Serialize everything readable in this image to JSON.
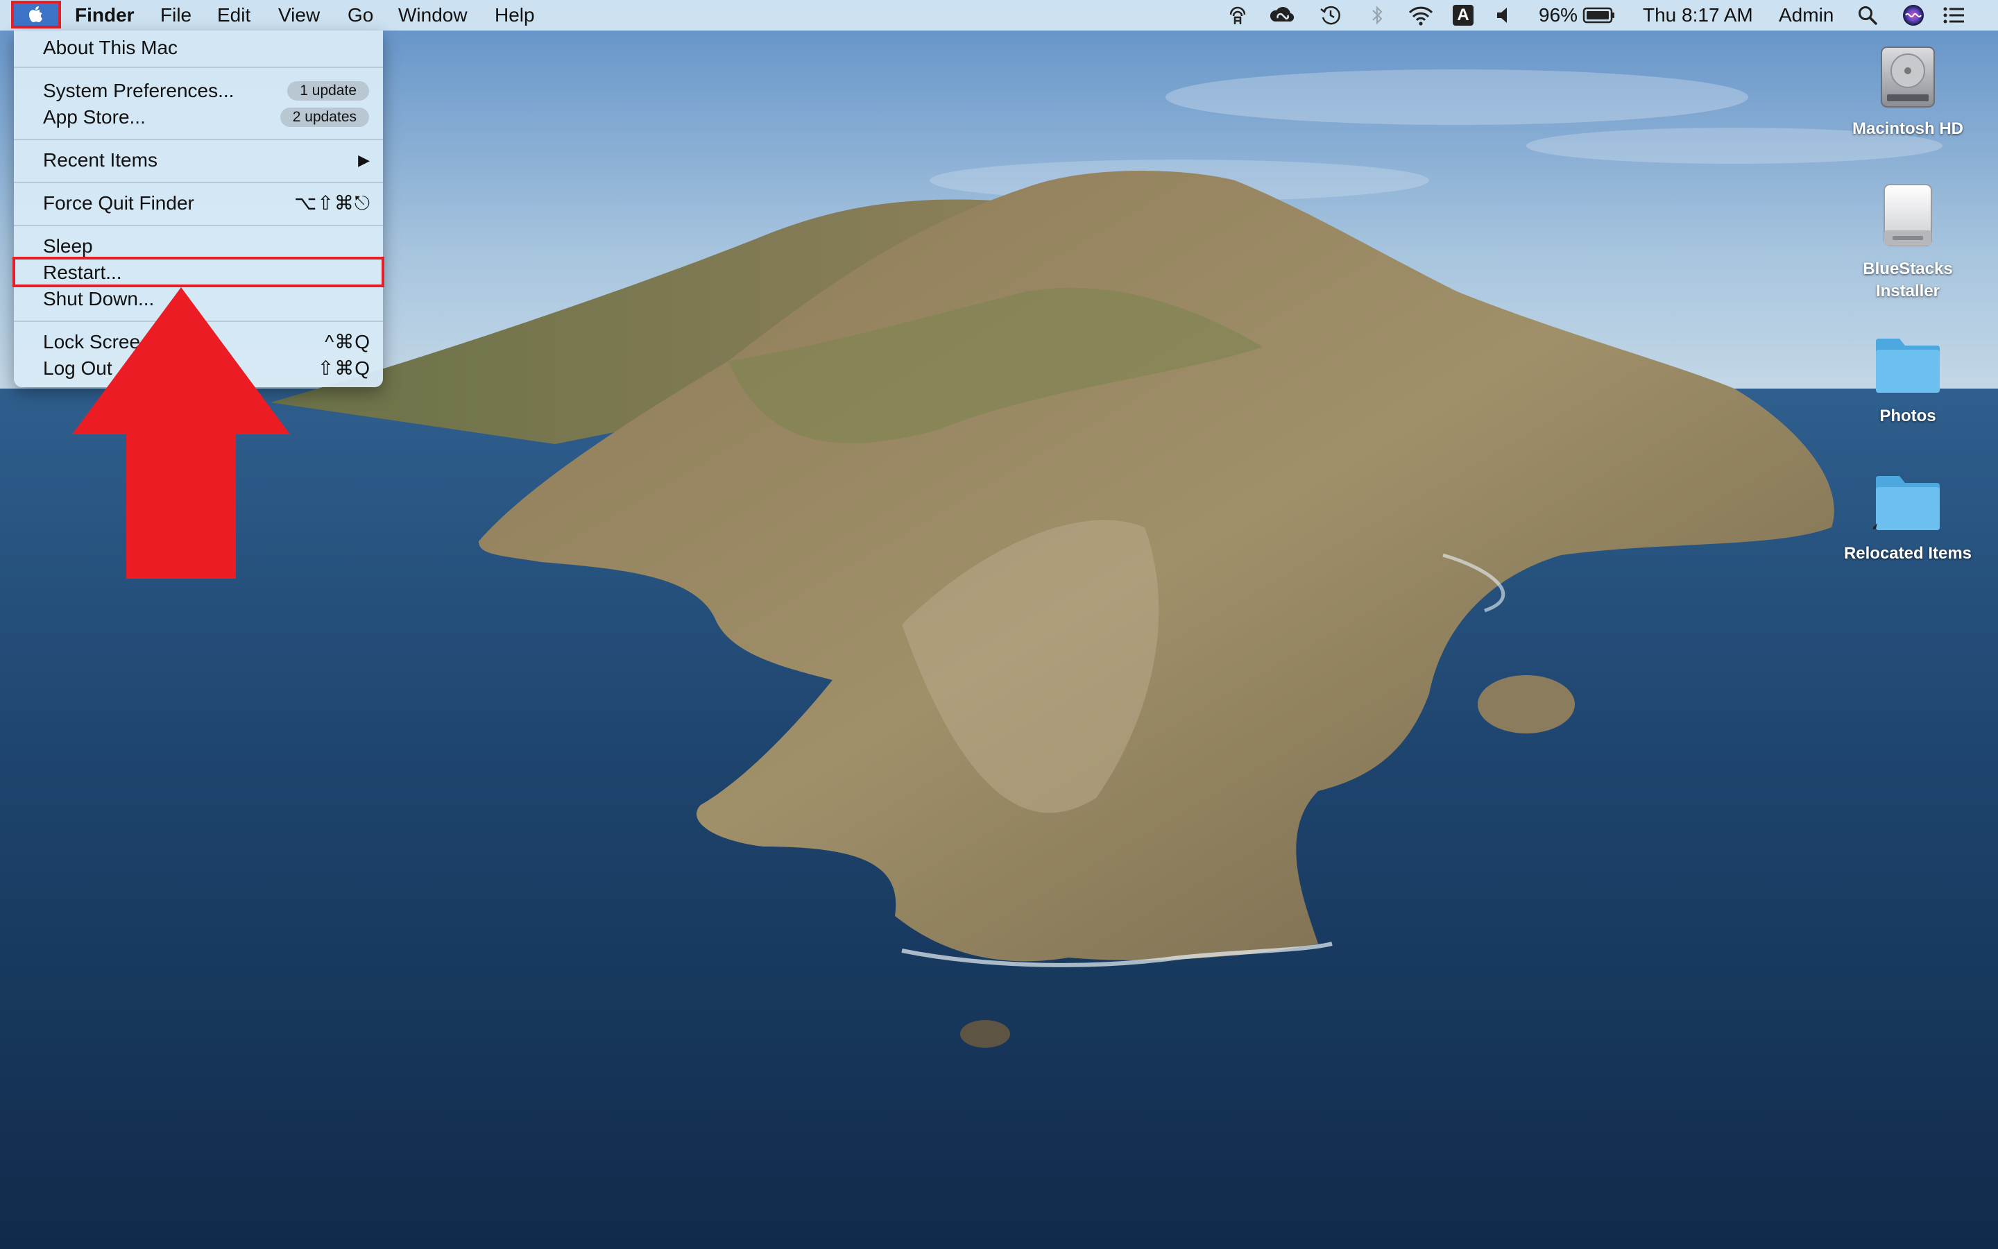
{
  "menubar": {
    "app_name": "Finder",
    "menus": [
      "File",
      "Edit",
      "View",
      "Go",
      "Window",
      "Help"
    ],
    "battery_percent": "96%",
    "clock": "Thu 8:17 AM",
    "user": "Admin",
    "status_icons": [
      "airdrop-icon",
      "creative-cloud-icon",
      "time-machine-icon",
      "bluetooth-icon",
      "wifi-icon",
      "input-source-icon",
      "volume-icon",
      "battery-icon",
      "spotlight-icon",
      "siri-icon",
      "notification-center-icon"
    ],
    "input_source_letter": "A"
  },
  "apple_menu": {
    "about": "About This Mac",
    "system_prefs": "System Preferences...",
    "system_prefs_badge": "1 update",
    "app_store": "App Store...",
    "app_store_badge": "2 updates",
    "recent_items": "Recent Items",
    "recent_items_arrow": "▶",
    "force_quit": "Force Quit Finder",
    "force_quit_shortcut": "⌥⇧⌘⎋",
    "sleep": "Sleep",
    "restart": "Restart...",
    "shut_down": "Shut Down...",
    "lock_screen": "Lock Scree",
    "lock_screen_shortcut": "^⌘Q",
    "log_out": "Log Out",
    "log_out_shortcut": "⇧⌘Q"
  },
  "desktop": {
    "icons": [
      {
        "name": "Macintosh HD",
        "kind": "hard-drive-icon"
      },
      {
        "name": "BlueStacks Installer",
        "kind": "disk-image-icon"
      },
      {
        "name": "Photos",
        "kind": "folder-icon"
      },
      {
        "name": "Relocated Items",
        "kind": "folder-alias-icon"
      }
    ]
  },
  "colors": {
    "highlight": "#e2202a",
    "folder": "#5cb6ea",
    "sky": "#6e9ac9",
    "ocean": "#1c3d63"
  }
}
